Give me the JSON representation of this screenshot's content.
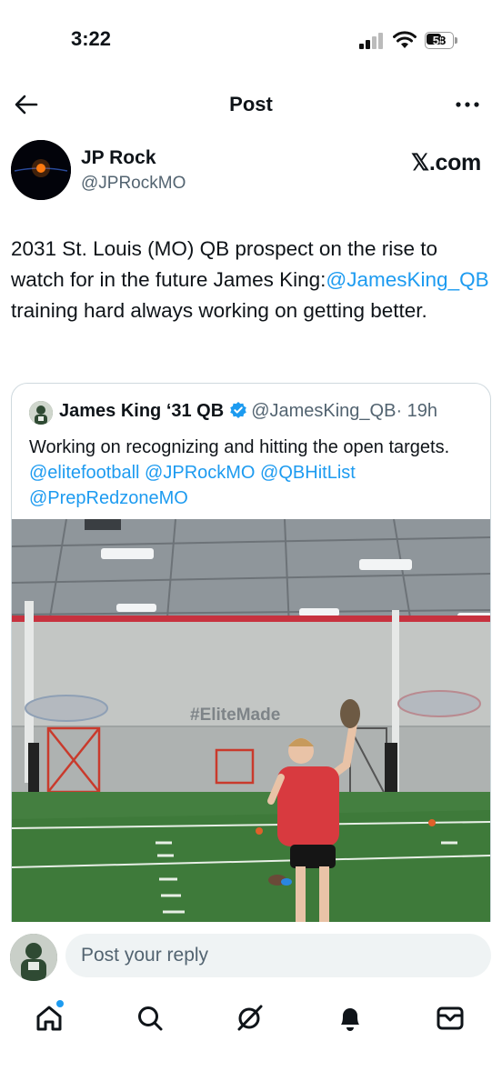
{
  "status_bar": {
    "time": "3:22",
    "battery": "58"
  },
  "header": {
    "title": "Post"
  },
  "author": {
    "name": "JP Rock",
    "handle": "@JPRockMO",
    "source_label": "𝕏.com"
  },
  "post": {
    "text_before": "2031 St. Louis (MO) QB prospect on the rise to watch for in the future James King:",
    "mention": "@JamesKing_QB",
    "text_after": " training hard always working on getting better."
  },
  "quote": {
    "name": "James King ‘31 QB",
    "handle": "@JamesKing_QB",
    "time": "· 19h",
    "text_before": "Working on recognizing and hitting the open targets. ",
    "mentions": [
      "@elitefootball",
      "@JPRockMO",
      "@QBHitList",
      "@PrepRedzoneMO"
    ],
    "media_wall_text": "#EliteMade"
  },
  "reply": {
    "placeholder": "Post your reply"
  },
  "nav": {
    "items": [
      "home-icon",
      "search-icon",
      "grok-icon",
      "notifications-icon",
      "messages-icon"
    ]
  },
  "colors": {
    "accent": "#1d9bf0",
    "text": "#0f1419",
    "secondary": "#536471"
  }
}
